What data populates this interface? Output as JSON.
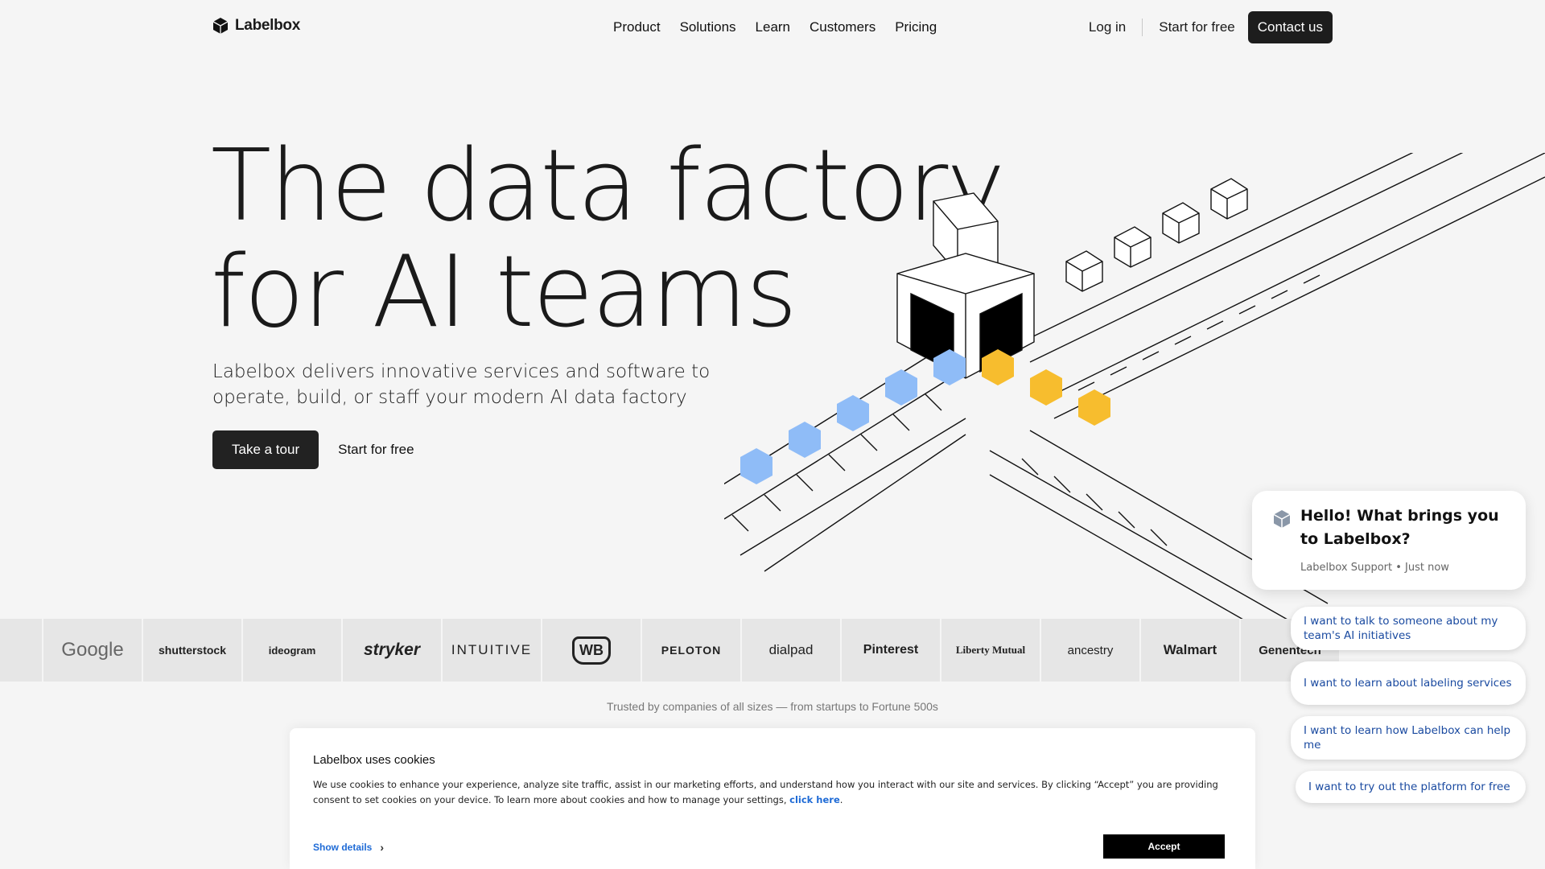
{
  "nav": {
    "brand": "Labelbox",
    "links": [
      "Product",
      "Solutions",
      "Learn",
      "Customers",
      "Pricing"
    ],
    "login": "Log in",
    "start_free": "Start for free",
    "contact": "Contact us"
  },
  "hero": {
    "title_line1": "The data factory",
    "title_line2": "for AI teams",
    "subtitle": "Labelbox delivers innovative services and software to operate, build, or staff your modern AI data factory",
    "tour_button": "Take a tour",
    "start_free": "Start for free"
  },
  "customers": {
    "logos": [
      "Google",
      "shutterstock",
      "ideogram",
      "stryker",
      "INTUITIVE",
      "WB",
      "PELOTON",
      "dialpad",
      "Pinterest",
      "Liberty Mutual",
      "ancestry",
      "Walmart",
      "Genentech"
    ],
    "trusted_text": "Trusted by companies of all sizes — from startups to Fortune 500s"
  },
  "cookie": {
    "title": "Labelbox uses cookies",
    "body": "We use cookies to enhance your experience, analyze site traffic, assist in our marketing efforts, and understand how you interact with our site and services. By clicking “Accept” you are providing consent to set cookies on your device. To learn more about cookies and how to manage your settings, ",
    "link": "click here",
    "show_details": "Show details",
    "accept": "Accept"
  },
  "chat": {
    "greeting": "Hello! What brings you to Labelbox?",
    "meta": "Labelbox Support • Just now",
    "options": [
      "I want to talk to someone about my team's AI initiatives",
      "I want to learn about labeling services",
      "I want to learn how Labelbox can help me",
      "I want to try out the platform for free"
    ]
  },
  "colors": {
    "accent_blue": "#8fbcf7",
    "accent_yellow": "#f7bd2e",
    "dark": "#1d1d1d",
    "link_blue": "#1f6bd6"
  },
  "icons": [
    "labelbox-logo-icon",
    "chevron-right-icon",
    "labelbox-avatar-icon"
  ]
}
